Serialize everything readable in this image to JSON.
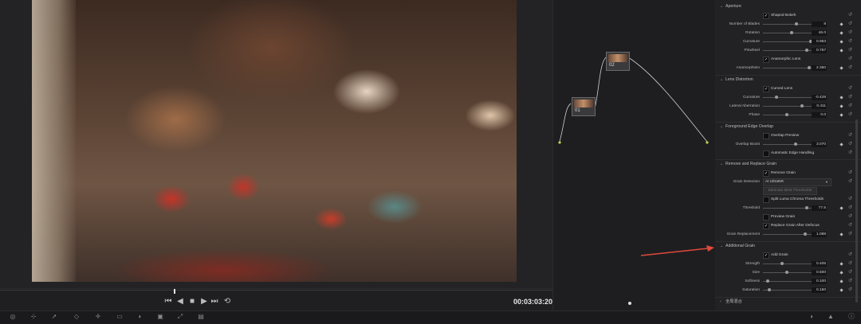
{
  "viewer": {
    "timecode": "00:03:03:20",
    "transport_icons": [
      "skip-back-icon",
      "step-back-icon",
      "stop-icon",
      "play-icon",
      "skip-forward-icon",
      "loop-icon"
    ]
  },
  "nodes": [
    {
      "label": "01"
    },
    {
      "label": "02"
    }
  ],
  "panel": {
    "aperture": {
      "title": "Aperture",
      "shaped_bokeh": {
        "label": "Shaped Bokeh",
        "checked": true
      },
      "number_of_blades": {
        "label": "Number of Blades",
        "value": "8"
      },
      "rotation": {
        "label": "Rotation",
        "value": "46.0"
      },
      "curvature": {
        "label": "Curvature",
        "value": "0.953"
      },
      "pinwheel": {
        "label": "Pinwheel",
        "value": "0.767"
      },
      "anamorphic_lens": {
        "label": "Anamorphic Lens",
        "checked": true
      },
      "anamorphism": {
        "label": "Anamorphism",
        "value": "2.350"
      }
    },
    "lens_distortion": {
      "title": "Lens Distortion",
      "curved_lens": {
        "label": "Curved Lens",
        "checked": true
      },
      "curvature": {
        "label": "Curvature",
        "value": "-0.428"
      },
      "lateral_aberration": {
        "label": "Lateral Aberration",
        "value": "0.411"
      },
      "phase": {
        "label": "Phase",
        "value": "0.0"
      }
    },
    "foreground_edge": {
      "title": "Foreground Edge Overlap",
      "overlap_preview": {
        "label": "Overlap Preview",
        "checked": false
      },
      "overlap_boost": {
        "label": "Overlap Boost",
        "value": "3.070"
      },
      "auto_edge": {
        "label": "Automatic Edge Handling",
        "checked": false
      }
    },
    "remove_replace_grain": {
      "title": "Remove and Replace Grain",
      "remove_grain": {
        "label": "Remove Grain",
        "checked": true
      },
      "grain_detection": {
        "label": "Grain Detection",
        "value": "AI UltraNR"
      },
      "estimate_button": "Estimate Best Thresholds",
      "split_luma": {
        "label": "Split Luma Chroma Thresholds",
        "checked": false
      },
      "threshold": {
        "label": "Threshold",
        "value": "77.5"
      },
      "preview_grain": {
        "label": "Preview Grain",
        "checked": false
      },
      "replace_after_defocus": {
        "label": "Replace Grain After Defocus",
        "checked": true
      },
      "grain_replacement": {
        "label": "Grain Replacement",
        "value": "1.088"
      }
    },
    "additional_grain": {
      "title": "Additional Grain",
      "add_grain": {
        "label": "Add Grain",
        "checked": true
      },
      "strength": {
        "label": "Strength",
        "value": "0.405"
      },
      "size": {
        "label": "Size",
        "value": "0.500"
      },
      "softness": {
        "label": "Softness",
        "value": "0.100"
      },
      "saturation": {
        "label": "Saturation",
        "value": "0.150"
      }
    },
    "global_blend": {
      "title": "全局混合"
    }
  },
  "colors": {
    "accent_arrow": "#e0483b",
    "node_link": "#cfcfcf"
  }
}
